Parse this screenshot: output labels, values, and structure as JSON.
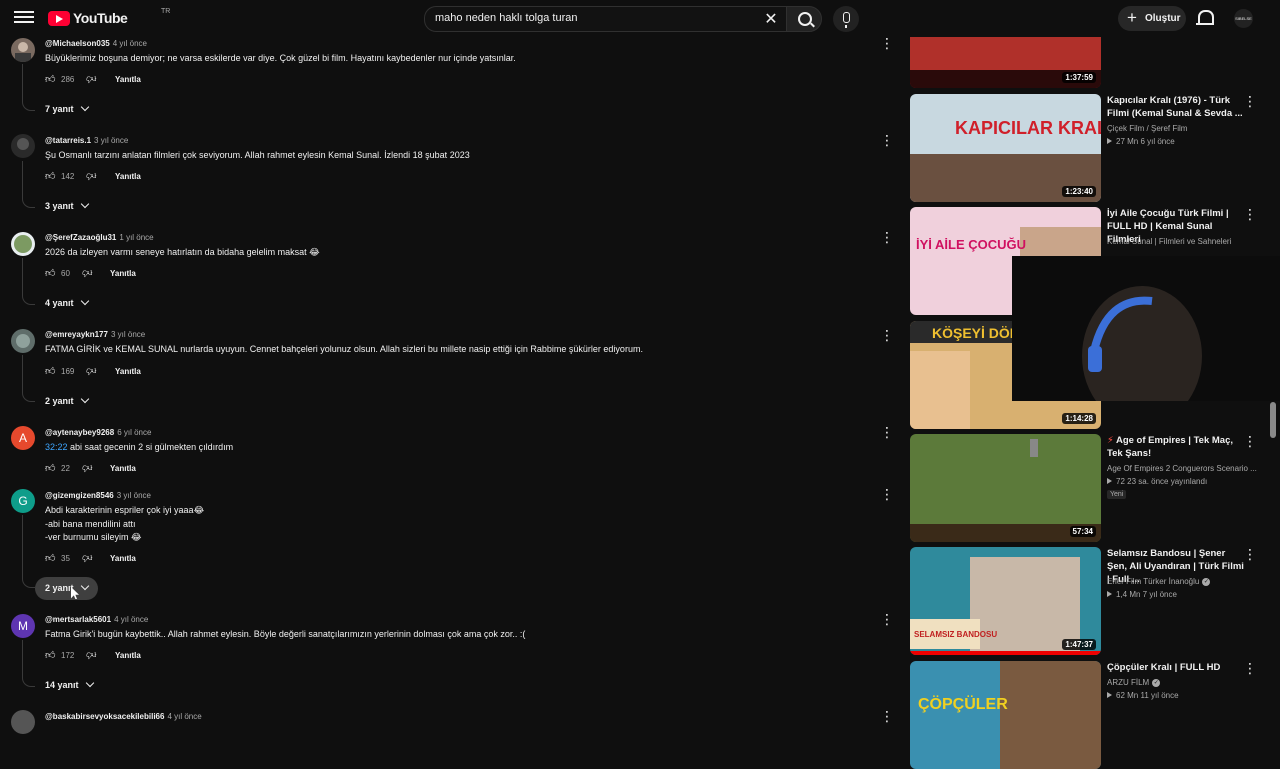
{
  "header": {
    "logo_text": "YouTube",
    "region": "TR",
    "search_value": "maho neden haklı tolga turan",
    "create_label": "Oluştur",
    "account_text": "SIBELSE"
  },
  "comments": [
    {
      "author": "@Michaelson035",
      "time": "4 yıl önce",
      "text": "Büyüklerimiz boşuna demiyor; ne varsa eskilerde var diye. Çok güzel bi film. Hayatını kaybedenler nur içinde yatsınlar.",
      "likes": "286",
      "reply": "Yanıtla",
      "replies": "7 yanıt",
      "avatar_color": "#7a6a60"
    },
    {
      "author": "@tatarreis.1",
      "time": "3 yıl önce",
      "text": "Şu Osmanlı tarzını anlatan filmleri çok seviyorum. Allah rahmet eylesin Kemal Sunal. İzlendi 18 şubat 2023",
      "likes": "142",
      "reply": "Yanıtla",
      "replies": "3 yanıt",
      "avatar_color": "#2a2a2a"
    },
    {
      "author": "@ŞerefZazaoğlu31",
      "time": "1 yıl önce",
      "text": "2026 da izleyen varmı seneye hatırlatın da bidaha gelelim maksat 😂",
      "likes": "60",
      "reply": "Yanıtla",
      "replies": "4 yanıt",
      "avatar_color": "#7c9a62"
    },
    {
      "author": "@emreyaykn177",
      "time": "3 yıl önce",
      "text": "FATMA GİRİK ve KEMAL SUNAL nurlarda uyuyun. Cennet bahçeleri yolunuz olsun. Allah sizleri bu millete nasip ettiği için Rabbime şükürler ediyorum.",
      "likes": "169",
      "reply": "Yanıtla",
      "replies": "2 yanıt",
      "avatar_color": "#5f6d6a"
    },
    {
      "author": "@aytenaybey9268",
      "time": "6 yıl önce",
      "timestamp_link": "32:22",
      "text": " abi saat gecenin 2 si gülmekten çıldırdım",
      "likes": "22",
      "reply": "Yanıtla",
      "avatar_letter": "A",
      "avatar_color": "#e6492d"
    },
    {
      "author": "@gizemgizen8546",
      "time": "3 yıl önce",
      "text": "Abdi karakterinin espriler çok iyi yaaa😂\n-abi bana mendilini attı\n-ver burnumu sileyim 😂",
      "likes": "35",
      "reply": "Yanıtla",
      "replies": "2 yanıt",
      "avatar_letter": "G",
      "avatar_color": "#0e9d8a"
    },
    {
      "author": "@mertsarlak5601",
      "time": "4 yıl önce",
      "text": "Fatma Girik'i bugün kaybettik.. Allah rahmet eylesin. Böyle değerli sanatçılarımızın yerlerinin dolması çok ama çok zor.. :(",
      "likes": "172",
      "reply": "Yanıtla",
      "replies": "14 yanıt",
      "avatar_letter": "M",
      "avatar_color": "#5e35b1"
    },
    {
      "author": "@baskabirsevyoksacekilebili66",
      "time": "4 yıl önce"
    }
  ],
  "sidebar": [
    {
      "title": "",
      "duration": "1:37:59",
      "thumb_color": "#8a1a1a"
    },
    {
      "title": "Kapıcılar Kralı (1976) - Türk Filmi (Kemal Sunal & Sevda ...",
      "channel": "Çiçek Film / Şeref Film",
      "stats": "27 Mn  6 yıl önce",
      "duration": "1:23:40",
      "thumb_color": "#c8d8e0",
      "thumb_text": "KAPICILAR KRALI"
    },
    {
      "title": "İyi Aile Çocuğu Türk Filmi | FULL HD | Kemal Sunal Filmleri",
      "channel": "Kemal Sunal | Filmleri ve Sahneleri",
      "thumb_color": "#f0d0dc",
      "thumb_text": "İYİ AİLE ÇOCUĞU"
    },
    {
      "title": "",
      "duration": "1:14:28",
      "thumb_color": "#d8b070",
      "thumb_text": "KÖŞEYİ DÖN"
    },
    {
      "title": "Age of Empires | Tek Maç, Tek Şans!",
      "channel": "Age Of Empires 2 Conguerors Scenario ...",
      "stats": "72  23 sa. önce yayınlandı",
      "badge": "Yeni",
      "duration": "57:34",
      "thumb_color": "#5c7a3a"
    },
    {
      "title": "Selamsız Bandosu | Şener Şen, Ali Uyandıran | Türk Filmi | Full ...",
      "channel": "Erler Film Türker İnanoğlu",
      "stats": "1,4 Mn  7 yıl önce",
      "duration": "1:47:37",
      "thumb_color": "#2f8a9c",
      "thumb_text": "SELAMSIZ BANDOSU"
    },
    {
      "title": "Çöpçüler Kralı | FULL HD",
      "channel": "ARZU FİLM",
      "stats": "62 Mn  11 yıl önce",
      "thumb_color": "#3a90b0",
      "thumb_text": "ÇÖPÇÜLER"
    }
  ],
  "colors": {
    "background": "#0f0f0f",
    "accent": "#ff0033",
    "link": "#3ea6ff"
  }
}
